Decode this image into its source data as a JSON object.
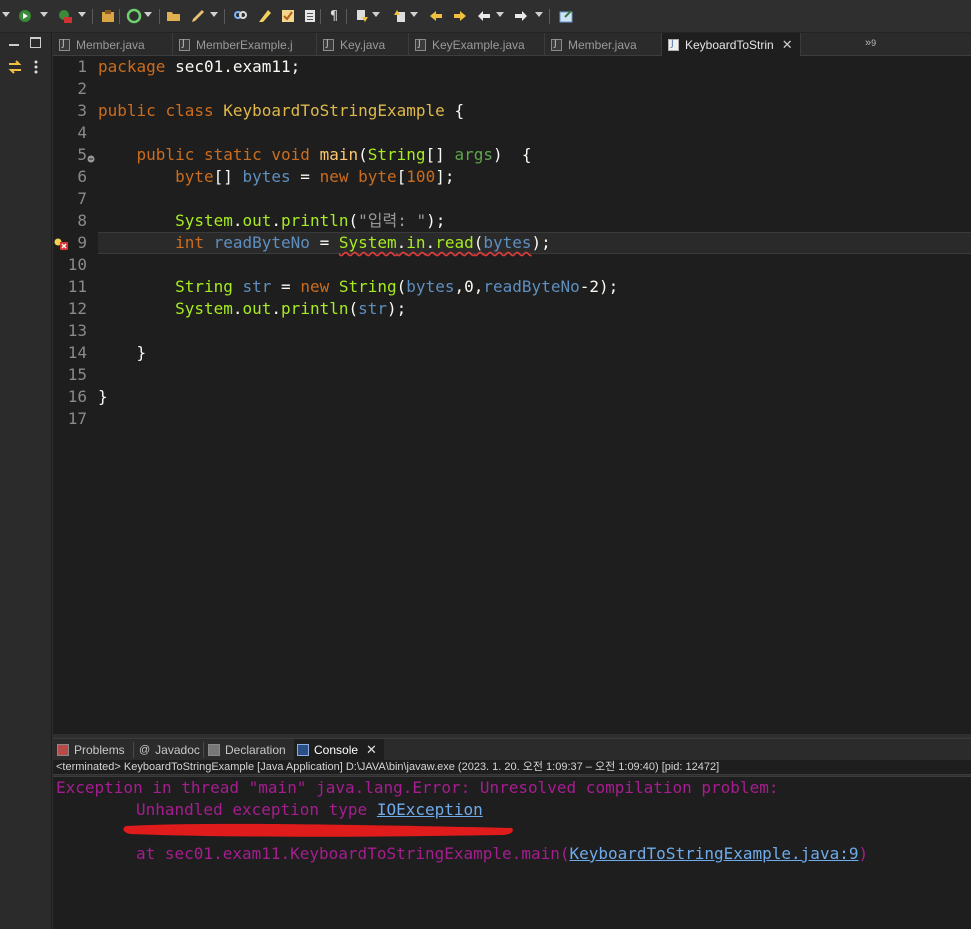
{
  "colors": {
    "editor_bg": "#1e1e1e",
    "keyword": "#cc6c1d",
    "method": "#a7ec21",
    "string": "#17c6a3",
    "console_error": "#a61d8f",
    "annotation": "#e01b1b"
  },
  "toolbar": {
    "icons": [
      "run-icon",
      "debug-icon",
      "coverage-icon",
      "new-package-icon",
      "refresh-icon",
      "open-folder-icon",
      "pen-icon",
      "search-icon",
      "highlight-icon",
      "task-icon",
      "outline-icon",
      "pilcrow-icon",
      "next-annotation-icon",
      "prev-annotation-icon",
      "back-icon",
      "forward-icon",
      "left-arrow-icon",
      "right-arrow-icon",
      "share-icon"
    ]
  },
  "editor_tabs": [
    {
      "label": "Member.java"
    },
    {
      "label": "MemberExample.j"
    },
    {
      "label": "Key.java"
    },
    {
      "label": "KeyExample.java"
    },
    {
      "label": "Member.java"
    },
    {
      "label": "KeyboardToStrin",
      "active": true
    }
  ],
  "editor_tabs_overflow": "9",
  "code": {
    "line_numbers": [
      "1",
      "2",
      "3",
      "4",
      "5",
      "6",
      "7",
      "8",
      "9",
      "10",
      "11",
      "12",
      "13",
      "14",
      "15",
      "16",
      "17"
    ],
    "l1_kw": "package",
    "l1_rest": " sec01.exam11;",
    "l3_kw1": "public",
    "l3_kw2": "class",
    "l3_name": "KeyboardToStringExample",
    "l3_brace": " {",
    "l5_kw1": "public",
    "l5_kw2": "static",
    "l5_kw3": "void",
    "l5_method": "main",
    "l5_open": "(",
    "l5_type": "String",
    "l5_arr": "[] ",
    "l5_param": "args",
    "l5_close": ")  {",
    "l6_type": "byte",
    "l6_arr": "[] ",
    "l6_var": "bytes",
    "l6_eq": " = ",
    "l6_new": "new",
    "l6_type2": "byte",
    "l6_open": "[",
    "l6_num": "100",
    "l6_close": "];",
    "l8_cls": "System",
    "l8_dot1": ".",
    "l8_field": "out",
    "l8_dot2": ".",
    "l8_method": "println",
    "l8_open": "(",
    "l8_str": "\"입력: \"",
    "l8_close": ");",
    "l9_type": "int",
    "l9_var": "readByteNo",
    "l9_eq": " = ",
    "l9_cls": "System",
    "l9_dot1": ".",
    "l9_field": "in",
    "l9_dot2": ".",
    "l9_method": "read",
    "l9_open": "(",
    "l9_arg": "bytes",
    "l9_close": ");",
    "l11_type": "String",
    "l11_var": "str",
    "l11_eq": " = ",
    "l11_new": "new",
    "l11_type2": "String",
    "l11_open": "(",
    "l11_arg1": "bytes",
    "l11_c1": ",",
    "l11_num1": "0",
    "l11_c2": ",",
    "l11_arg2": "readByteNo",
    "l11_minus": "-",
    "l11_num2": "2",
    "l11_close": ");",
    "l12_cls": "System",
    "l12_dot1": ".",
    "l12_field": "out",
    "l12_dot2": ".",
    "l12_method": "println",
    "l12_open": "(",
    "l12_arg": "str",
    "l12_close": ");",
    "l14": "}",
    "l16": "}"
  },
  "bottom_panel": {
    "tabs": [
      {
        "label": "Problems"
      },
      {
        "label": "Javadoc"
      },
      {
        "label": "Declaration"
      },
      {
        "label": "Console",
        "active": true
      }
    ],
    "status": "<terminated> KeyboardToStringExample [Java Application] D:\\JAVA\\bin\\javaw.exe  (2023. 1. 20. 오전 1:09:37 – 오전 1:09:40) [pid: 12472]",
    "console_line1": "Exception in thread \"main\" java.lang.Error: Unresolved compilation problem: ",
    "console_line2_text": "Unhandled exception type ",
    "console_line2_link": "IOException",
    "console_line3_text": "at sec01.exam11.KeyboardToStringExample.main(",
    "console_line3_link": "KeyboardToStringExample.java:9",
    "console_line3_end": ")"
  }
}
